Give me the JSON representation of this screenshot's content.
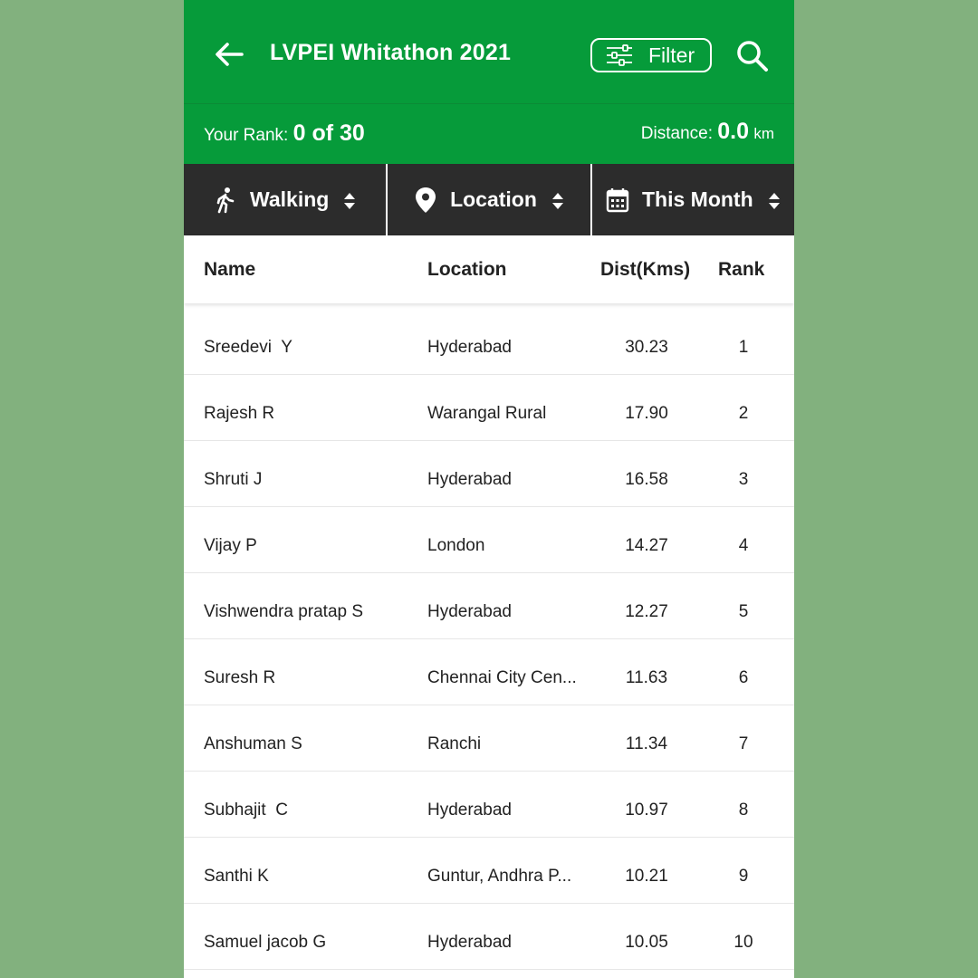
{
  "appbar": {
    "title": "LVPEI Whitathon 2021",
    "filter_label": "Filter",
    "back_icon": "arrow-left-icon",
    "filter_icon": "sliders-icon",
    "search_icon": "search-icon"
  },
  "rank_bar": {
    "rank_label": "Your Rank:",
    "rank_value": "0 of 30",
    "distance_label": "Distance:",
    "distance_value": "0.0",
    "distance_unit": "km"
  },
  "tabs": [
    {
      "label": "Walking",
      "icon": "walking-icon"
    },
    {
      "label": "Location",
      "icon": "location-pin-icon"
    },
    {
      "label": "This Month",
      "icon": "calendar-icon"
    }
  ],
  "table": {
    "headers": {
      "name": "Name",
      "location": "Location",
      "dist": "Dist(Kms)",
      "rank": "Rank"
    },
    "rows": [
      {
        "name": "Sreedevi  Y",
        "location": "Hyderabad",
        "dist": "30.23",
        "rank": "1"
      },
      {
        "name": "Rajesh R",
        "location": "Warangal Rural",
        "dist": "17.90",
        "rank": "2"
      },
      {
        "name": "Shruti J",
        "location": "Hyderabad",
        "dist": "16.58",
        "rank": "3"
      },
      {
        "name": "Vijay P",
        "location": "London",
        "dist": "14.27",
        "rank": "4"
      },
      {
        "name": "Vishwendra pratap S",
        "location": "Hyderabad",
        "dist": "12.27",
        "rank": "5"
      },
      {
        "name": "Suresh R",
        "location": "Chennai City Cen...",
        "dist": "11.63",
        "rank": "6"
      },
      {
        "name": "Anshuman S",
        "location": "Ranchi",
        "dist": "11.34",
        "rank": "7"
      },
      {
        "name": "Subhajit  C",
        "location": "Hyderabad",
        "dist": "10.97",
        "rank": "8"
      },
      {
        "name": "Santhi K",
        "location": "Guntur, Andhra P...",
        "dist": "10.21",
        "rank": "9"
      },
      {
        "name": "Samuel jacob G",
        "location": "Hyderabad",
        "dist": "10.05",
        "rank": "10"
      }
    ]
  },
  "colors": {
    "primary_green": "#069b3a",
    "tab_bar": "#2c2c2c",
    "background": "#82b17e"
  }
}
